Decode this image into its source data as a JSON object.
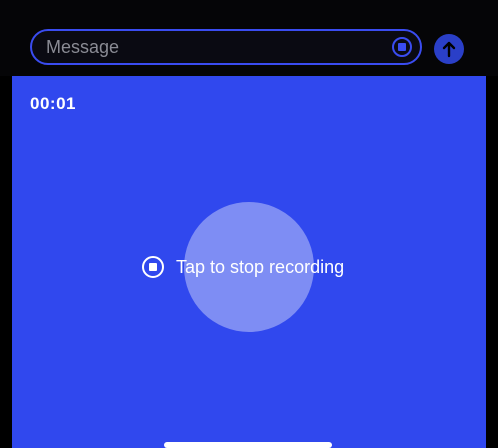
{
  "composer": {
    "placeholder": "Message",
    "stop_icon": "stop-circle-icon",
    "send_icon": "arrow-up-icon"
  },
  "recording": {
    "elapsed": "00:01",
    "stop_label": "Tap to stop recording",
    "stop_icon": "stop-circle-icon"
  },
  "colors": {
    "accent": "#3048ee",
    "field_border": "#3a4cf0",
    "send_button": "#2a3fc8"
  }
}
